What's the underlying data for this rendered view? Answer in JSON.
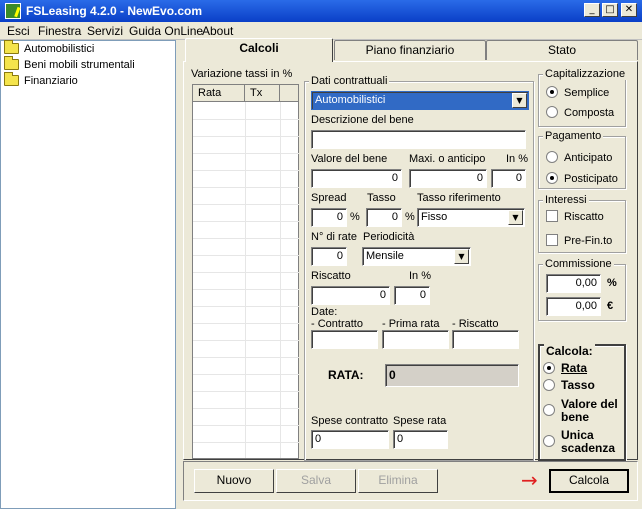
{
  "window": {
    "title": "FSLeasing 4.2.0 - NewEvo.com",
    "controls": [
      "_",
      "□",
      "✕"
    ]
  },
  "menu": [
    "Esci",
    "Finestra",
    "Servizi",
    "Guida OnLine",
    "About"
  ],
  "tree": [
    "Automobilistici",
    "Beni mobili strumentali",
    "Finanziario"
  ],
  "tabs": [
    "Calcoli",
    "Piano finanziario",
    "Stato"
  ],
  "variazione": {
    "label": "Variazione tassi in %",
    "col_rata": "Rata",
    "col_tx": "Tx"
  },
  "dati": {
    "title": "Dati contrattuali",
    "categoria": "Automobilistici",
    "descrizione_label": "Descrizione del bene",
    "descrizione_value": "",
    "valore_label": "Valore del bene",
    "valore_value": "0",
    "maxi_label": "Maxi. o anticipo",
    "maxi_value": "0",
    "in_pct_label": "In %",
    "in_pct_value": "0",
    "spread_label": "Spread",
    "spread_value": "0",
    "tasso_label": "Tasso",
    "tasso_value": "0",
    "pct_sign": "%",
    "tasso_rif_label": "Tasso riferimento",
    "tasso_rif_value": "Fisso",
    "nrate_label": "N° di rate",
    "nrate_value": "0",
    "periodicita_label": "Periodicità",
    "periodicita_value": "Mensile",
    "riscatto_label": "Riscatto",
    "riscatto_value": "0",
    "riscatto_in_label": "In %",
    "riscatto_in_value": "0",
    "date_label": "Date:",
    "contratto_label": "- Contratto",
    "prima_rata_label": "- Prima rata",
    "riscatto_date_label": "- Riscatto",
    "rata_label": "RATA:",
    "rata_value": "0",
    "spese_contratto_label": "Spese contratto",
    "spese_contratto_value": "0",
    "spese_rata_label": "Spese rata",
    "spese_rata_value": "0"
  },
  "capitalizzazione": {
    "title": "Capitalizzazione",
    "options": [
      "Semplice",
      "Composta"
    ],
    "selected": 0
  },
  "pagamento": {
    "title": "Pagamento",
    "options": [
      "Anticipato",
      "Posticipato"
    ],
    "selected": 1
  },
  "interessi": {
    "title": "Interessi",
    "options": [
      "Riscatto",
      "Pre-Fin.to"
    ]
  },
  "commissione": {
    "title": "Commissione",
    "pct_value": "0,00",
    "pct_unit": "%",
    "eur_value": "0,00",
    "eur_unit": "€"
  },
  "calcola": {
    "title": "Calcola:",
    "options": [
      "Rata",
      "Tasso",
      "Valore del bene",
      "Unica scadenza"
    ],
    "selected": 0
  },
  "buttons": {
    "nuovo": "Nuovo",
    "salva": "Salva",
    "elimina": "Elimina",
    "calcola": "Calcola",
    "arrow": "→"
  },
  "colors": {
    "title_bar": "#0a3fc7",
    "face": "#ece9d8",
    "arrow": "#e02020"
  }
}
